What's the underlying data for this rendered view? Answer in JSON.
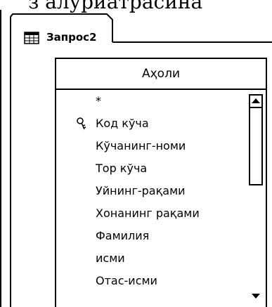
{
  "header_text": "з алуриатрасина",
  "tab": {
    "label": "Запрос2",
    "icon": "query-table-icon"
  },
  "table": {
    "title": "Аҳоли",
    "fields": [
      {
        "label": "*",
        "key": false
      },
      {
        "label": "Код кўча",
        "key": true
      },
      {
        "label": "Кўчанинг-номи",
        "key": false
      },
      {
        "label": "Тор кўча",
        "key": false
      },
      {
        "label": "Уйнинг-рақами",
        "key": false
      },
      {
        "label": "Хонанинг рақами",
        "key": false
      },
      {
        "label": "Фамилия",
        "key": false
      },
      {
        "label": "исми",
        "key": false
      },
      {
        "label": "Отас-исми",
        "key": false
      }
    ]
  },
  "scrollbar": {
    "up_icon": "scroll-up-arrow-icon",
    "down_icon": "scroll-down-arrow-icon"
  }
}
